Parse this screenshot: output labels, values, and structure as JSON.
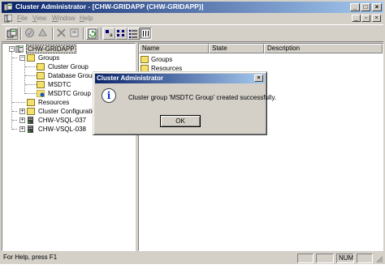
{
  "window": {
    "title": "Cluster Administrator - [CHW-GRIDAPP (CHW-GRIDAPP)]"
  },
  "menu": {
    "items": [
      "File",
      "View",
      "Window",
      "Help"
    ]
  },
  "tree": {
    "root": "CHW-GRIDAPP",
    "groups": "Groups",
    "cluster_group": "Cluster Group",
    "database_group": "Database Group",
    "msdtc": "MSDTC",
    "msdtc_group": "MSDTC Group",
    "resources": "Resources",
    "cluster_configuration": "Cluster Configuration",
    "node1": "CHW-VSQL-037",
    "node2": "CHW-VSQL-038"
  },
  "list": {
    "columns": {
      "name": "Name",
      "state": "State",
      "description": "Description"
    },
    "rows": [
      "Groups",
      "Resources"
    ]
  },
  "status": {
    "help": "For Help, press F1",
    "num": "NUM"
  },
  "dialog": {
    "title": "Cluster Administrator",
    "message": "Cluster group 'MSDTC Group' created successfully.",
    "ok": "OK"
  },
  "colors": {
    "title_active": "#0a246a",
    "title_gradient_end": "#a6caf0",
    "face": "#d4d0c8"
  }
}
